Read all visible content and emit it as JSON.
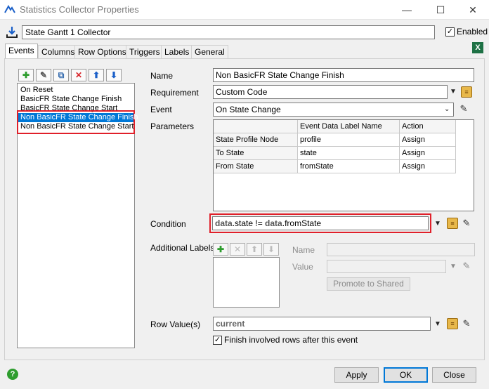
{
  "window": {
    "title": "Statistics Collector Properties",
    "minimize": "—",
    "maximize": "☐",
    "close": "✕"
  },
  "object": {
    "name": "State Gantt 1 Collector",
    "enabled_label": "Enabled",
    "enabled_checked": "✓"
  },
  "tabs": [
    "Events",
    "Columns",
    "Row Options",
    "Triggers",
    "Labels",
    "General"
  ],
  "toolbar": {
    "add": "✚",
    "sample": "✎",
    "copy": "⧉",
    "delete": "✕",
    "up": "⬆",
    "down": "⬇"
  },
  "event_list": {
    "items": [
      "On Reset",
      "BasicFR State Change Finish",
      "BasicFR State Change Start",
      "Non BasicFR State Change Finish",
      "Non BasicFR State Change Start"
    ],
    "selected_index": 3
  },
  "form": {
    "name_label": "Name",
    "name_value": "Non BasicFR State Change Finish",
    "requirement_label": "Requirement",
    "requirement_value": "Custom Code",
    "event_label": "Event",
    "event_value": "On State Change",
    "parameters_label": "Parameters",
    "condition_label": "Condition",
    "condition_kw1": "data",
    "condition_mid": ".state != ",
    "condition_kw2": "data",
    "condition_end": ".fromState",
    "additional_labels_label": "Additional Labels",
    "al_name_label": "Name",
    "al_value_label": "Value",
    "promote_label": "Promote to Shared",
    "row_values_label": "Row Value(s)",
    "row_values_value": "current",
    "finish_rows_label": "Finish involved rows after this event",
    "finish_rows_checked": "✓"
  },
  "parameters": {
    "headers": [
      "",
      "Event Data Label Name",
      "Action"
    ],
    "rows": [
      [
        "State Profile Node",
        "profile",
        "Assign"
      ],
      [
        "To State",
        "state",
        "Assign"
      ],
      [
        "From State",
        "fromState",
        "Assign"
      ]
    ]
  },
  "buttons": {
    "apply": "Apply",
    "ok": "OK",
    "close": "Close",
    "help": "?"
  },
  "colors": {
    "selection": "#0078d7",
    "highlight_box": "#e0202a",
    "add_green": "#2e9d2e",
    "delete_red": "#d8262b",
    "arrow_blue": "#1a5fc8"
  }
}
